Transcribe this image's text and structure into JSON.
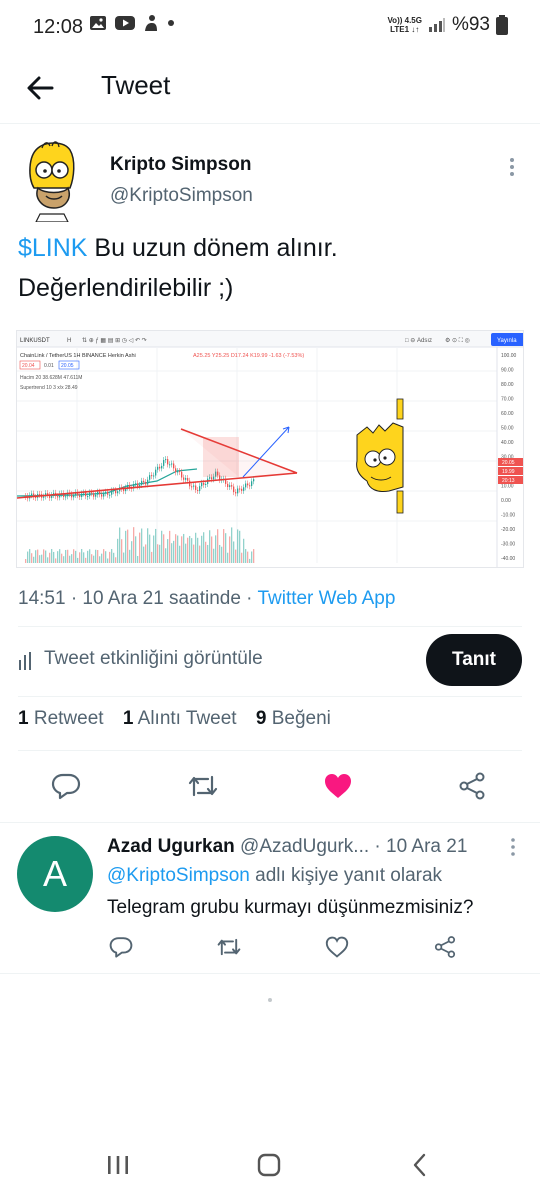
{
  "status_bar": {
    "time": "12:08",
    "network_top": "Vo)) 4.5G",
    "network_bottom": "LTE1 ↓↑",
    "battery": "%93"
  },
  "header": {
    "title": "Tweet"
  },
  "tweet": {
    "author_name": "Kripto Simpson",
    "author_handle": "@KriptoSimpson",
    "text_hashtag": "$LINK",
    "text_rest": " Bu uzun dönem alınır. Değerlendirilebilir ;)",
    "time": "14:51 · 10 Ara 21 saatinde · ",
    "source": "Twitter Web App",
    "activity_label": "Tweet etkinliğini görüntüle",
    "promote_label": "Tanıt",
    "stats": {
      "retweets_count": "1",
      "retweets_label": "Retweet",
      "quotes_count": "1",
      "quotes_label": "Alıntı Tweet",
      "likes_count": "9",
      "likes_label": "Beğeni"
    }
  },
  "chart_image": {
    "symbol": "LINKUSDT",
    "interval": "1H",
    "title_line": "ChainLink / TetherUS  1H  BINANCE  Herkin Ashi",
    "ohlc": "A25.25 Y25.25 D17.24 K19.99 -1.63 (-7.53%)",
    "badges": [
      "20.04",
      "0.01",
      "20.05"
    ],
    "indicator_1": "Hacim 20  38.628M  47.611M",
    "indicator_2": "Supertrend 10 3  x/x  28.49",
    "publish_label": "Yayınla",
    "save_label": "Adsız",
    "price_axis": [
      "100.00",
      "90.00",
      "80.00",
      "70.00",
      "60.00",
      "50.00",
      "40.00",
      "30.00",
      "20.00",
      "10.00",
      "0.00",
      "-10.00",
      "-20.00",
      "-30.00",
      "-40.00"
    ],
    "price_tags": [
      "20.05",
      "19.99",
      "20:13"
    ]
  },
  "reply": {
    "avatar_letter": "A",
    "name": "Azad Ugurkan",
    "handle": "@AzadUgurk...",
    "date": " · 10 Ara 21",
    "mention": "@KriptoSimpson",
    "reply_to_rest": " adlı kişiye yanıt olarak",
    "text": "Telegram grubu kurmayı düşünmezmisiniz?"
  },
  "colors": {
    "accent": "#1d9bf0",
    "like": "#f91880",
    "promote_bg": "#0f1419",
    "reply_avatar": "#148a6f"
  }
}
